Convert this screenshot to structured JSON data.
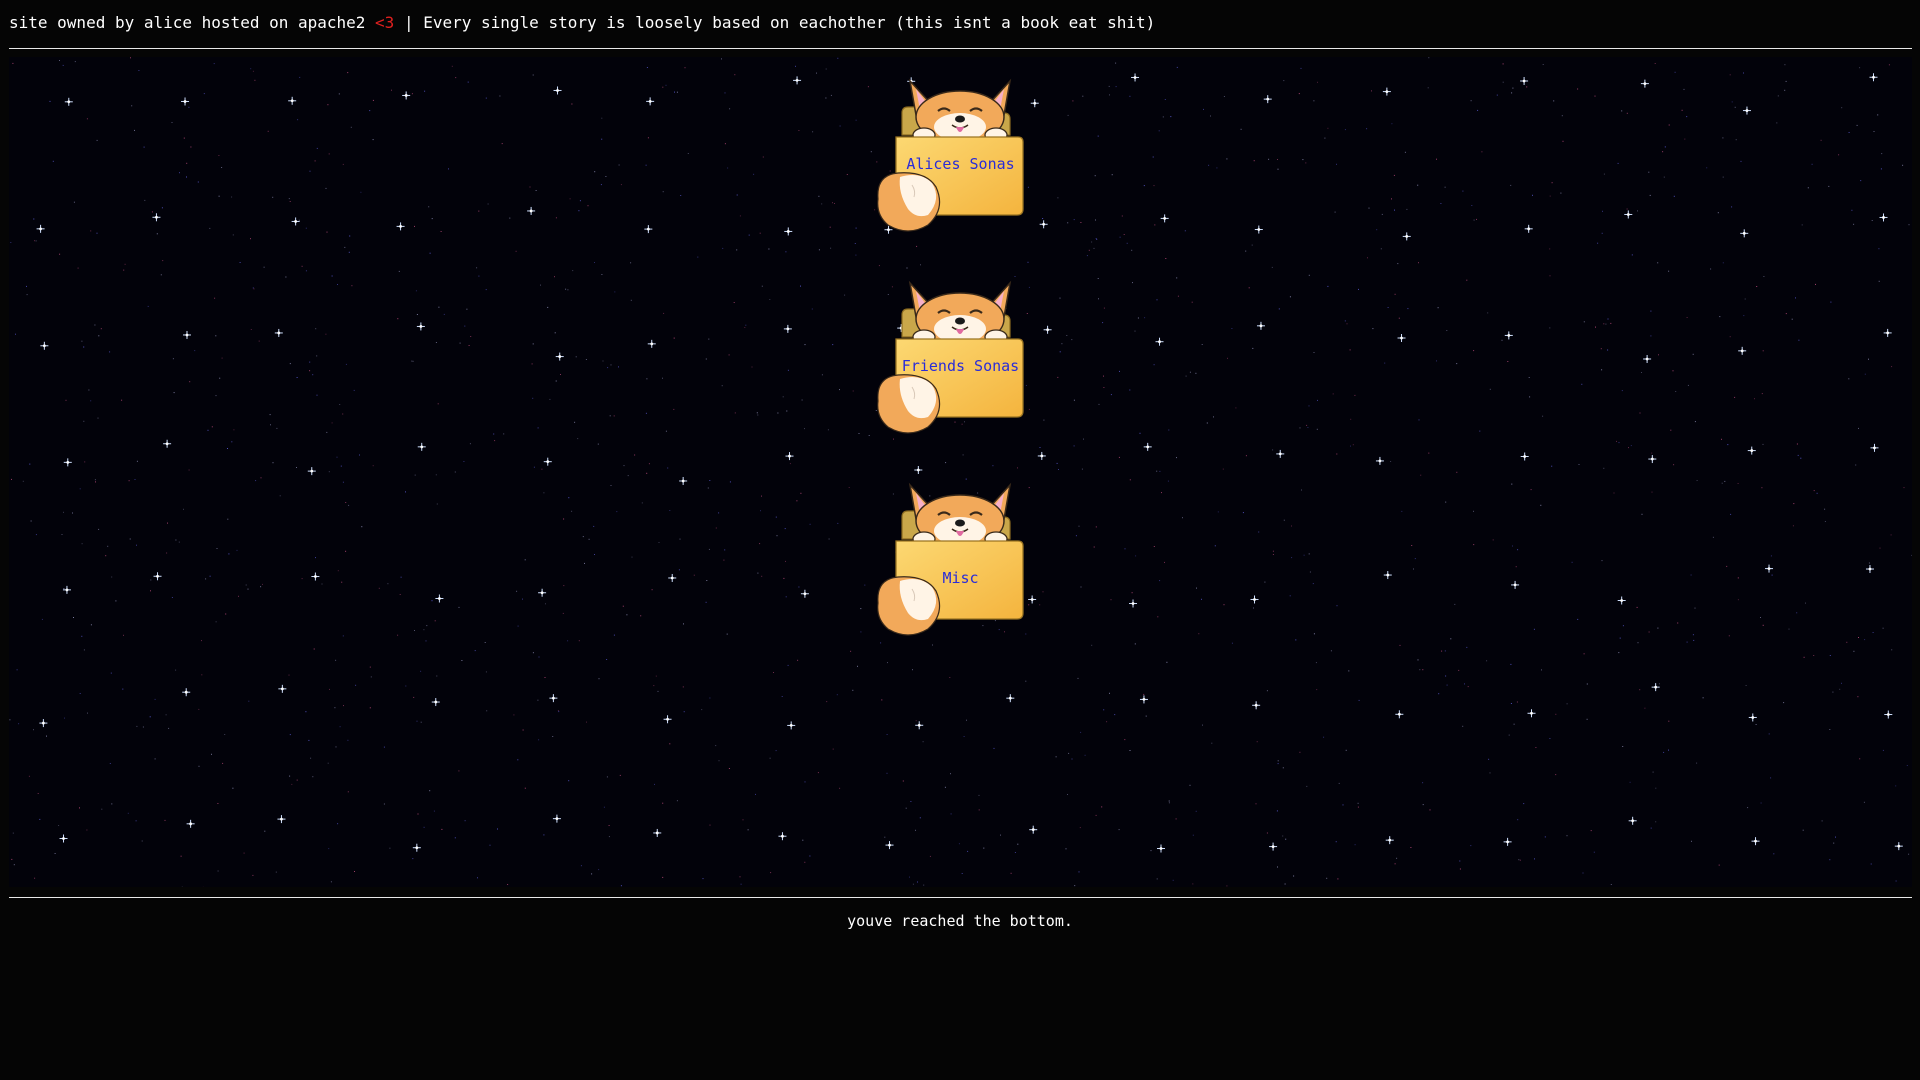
{
  "header": {
    "text_before_heart": "site owned by alice hosted on apache2 ",
    "heart": "<3",
    "text_after_heart": " | Every single story is loosely based on eachother (this isnt a book eat shit)",
    "heart_color": "#e0201f"
  },
  "folders": [
    {
      "label": "Alices Sonas",
      "icon": "fox-folder-icon"
    },
    {
      "label": "Friends Sonas",
      "icon": "fox-folder-icon"
    },
    {
      "label": "Misc",
      "icon": "fox-folder-icon"
    }
  ],
  "footer": {
    "text": "youve reached the bottom."
  },
  "colors": {
    "background": "#050505",
    "starfield": "#02020a",
    "folder_label": "#2a2cd8",
    "folder": "#f6c24a",
    "fox": "#f0a050"
  }
}
